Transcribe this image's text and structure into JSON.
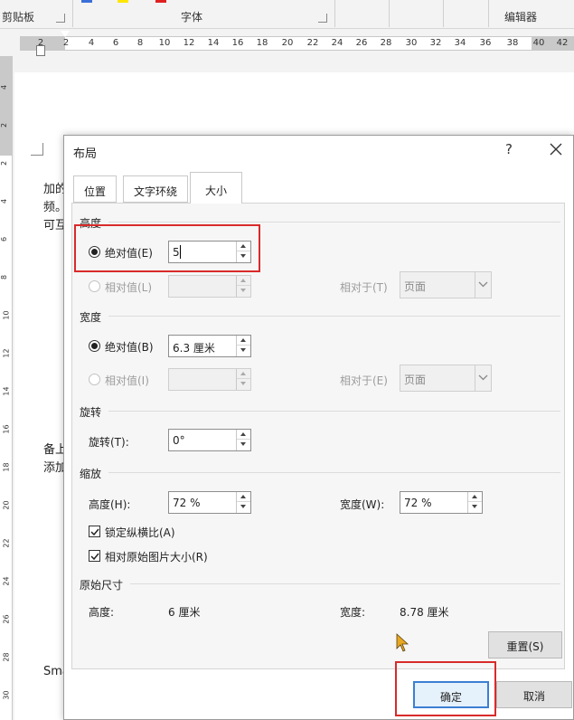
{
  "ribbon": {
    "groups": [
      "剪贴板",
      "字体",
      "编辑器"
    ],
    "swatch_colors": [
      "#3b6fd8",
      "#ffe600",
      "#e02020"
    ]
  },
  "ruler": {
    "h_numbers": [
      "2",
      "2",
      "4",
      "6",
      "8",
      "10",
      "12",
      "14",
      "16",
      "18",
      "20",
      "22",
      "24",
      "26",
      "28",
      "30",
      "32",
      "34",
      "36",
      "38",
      "40",
      "42"
    ],
    "v_numbers": [
      "4",
      "2",
      "2",
      "4",
      "6",
      "8",
      "10",
      "12",
      "14",
      "16",
      "18",
      "20",
      "22",
      "24",
      "26",
      "28",
      "30"
    ]
  },
  "document": {
    "lines": [
      "加的",
      "频。",
      "可互",
      "备上",
      "添加",
      "Sma"
    ]
  },
  "dialog": {
    "title": "布局",
    "help_label": "?",
    "tabs": [
      {
        "label": "位置",
        "active": false
      },
      {
        "label": "文字环绕",
        "active": false
      },
      {
        "label": "大小",
        "active": true
      }
    ],
    "height": {
      "section": "高度",
      "absolute_label": "绝对值(E)",
      "absolute_value": "5",
      "relative_label": "相对值(L)",
      "relative_value": "",
      "relative_to_label": "相对于(T)",
      "relative_to_value": "页面"
    },
    "width": {
      "section": "宽度",
      "absolute_label": "绝对值(B)",
      "absolute_value": "6.3 厘米",
      "relative_label": "相对值(I)",
      "relative_value": "",
      "relative_to_label": "相对于(E)",
      "relative_to_value": "页面"
    },
    "rotation": {
      "section": "旋转",
      "label": "旋转(T):",
      "value": "0°"
    },
    "scale": {
      "section": "缩放",
      "height_label": "高度(H):",
      "height_value": "72 %",
      "width_label": "宽度(W):",
      "width_value": "72 %",
      "lock_aspect_label": "锁定纵横比(A)",
      "lock_aspect_checked": true,
      "relative_original_label": "相对原始图片大小(R)",
      "relative_original_checked": true
    },
    "original": {
      "section": "原始尺寸",
      "height_label": "高度:",
      "height_value": "6 厘米",
      "width_label": "宽度:",
      "width_value": "8.78 厘米"
    },
    "reset_label": "重置(S)",
    "ok_label": "确定",
    "cancel_label": "取消"
  },
  "colors": {
    "highlight": "#d92a2a",
    "primary_border": "#3c7fd4"
  }
}
